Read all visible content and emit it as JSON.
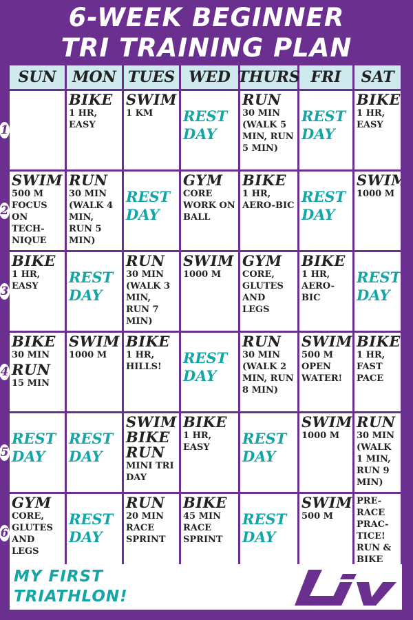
{
  "title": {
    "line1": "6-WEEK BEGINNER",
    "line2": "TRI TRAINING PLAN"
  },
  "days": [
    "SUN",
    "MON",
    "TUES",
    "WED",
    "THURS",
    "FRI",
    "SAT"
  ],
  "weeks": [
    {
      "label": "1",
      "cells": [
        {
          "lines": []
        },
        {
          "lines": [
            {
              "k": "act",
              "t": "BIKE"
            },
            {
              "k": "det",
              "t": "1 HR, EASY"
            }
          ]
        },
        {
          "lines": [
            {
              "k": "act",
              "t": "SWIM"
            },
            {
              "k": "det",
              "t": "1 KM"
            }
          ]
        },
        {
          "lines": [
            {
              "k": "rest",
              "t": "REST DAY"
            }
          ]
        },
        {
          "lines": [
            {
              "k": "act",
              "t": "RUN"
            },
            {
              "k": "det",
              "t": "30 MIN (WALK 5 MIN, RUN 5 MIN)"
            }
          ]
        },
        {
          "lines": [
            {
              "k": "rest",
              "t": "REST DAY"
            }
          ]
        },
        {
          "lines": [
            {
              "k": "act",
              "t": "BIKE"
            },
            {
              "k": "det",
              "t": "1 HR, EASY"
            }
          ]
        }
      ]
    },
    {
      "label": "2",
      "cells": [
        {
          "lines": [
            {
              "k": "act",
              "t": "SWIM"
            },
            {
              "k": "det",
              "t": "500 M FOCUS ON TECH-NIQUE"
            }
          ]
        },
        {
          "lines": [
            {
              "k": "act",
              "t": "RUN"
            },
            {
              "k": "det",
              "t": "30 MIN (WALK 4 MIN, RUN 5 MIN)"
            }
          ]
        },
        {
          "lines": [
            {
              "k": "rest",
              "t": "REST DAY"
            }
          ]
        },
        {
          "lines": [
            {
              "k": "act",
              "t": "GYM"
            },
            {
              "k": "det",
              "t": "CORE WORK ON BALL"
            }
          ]
        },
        {
          "lines": [
            {
              "k": "act",
              "t": "BIKE"
            },
            {
              "k": "det",
              "t": "1 HR, AERO-BIC"
            }
          ]
        },
        {
          "lines": [
            {
              "k": "rest",
              "t": "REST DAY"
            }
          ]
        },
        {
          "lines": [
            {
              "k": "act",
              "t": "SWIM"
            },
            {
              "k": "det",
              "t": "1000 M"
            }
          ]
        }
      ]
    },
    {
      "label": "3",
      "cells": [
        {
          "lines": [
            {
              "k": "act",
              "t": "BIKE"
            },
            {
              "k": "det",
              "t": "1 HR, EASY"
            }
          ]
        },
        {
          "lines": [
            {
              "k": "rest",
              "t": "REST DAY"
            }
          ]
        },
        {
          "lines": [
            {
              "k": "act",
              "t": "RUN"
            },
            {
              "k": "det",
              "t": "30 MIN (WALK 3 MIN, RUN 7 MIN)"
            }
          ]
        },
        {
          "lines": [
            {
              "k": "act",
              "t": "SWIM"
            },
            {
              "k": "det",
              "t": "1000 M"
            }
          ]
        },
        {
          "lines": [
            {
              "k": "act",
              "t": "GYM"
            },
            {
              "k": "det",
              "t": "CORE, GLUTES AND LEGS"
            }
          ]
        },
        {
          "lines": [
            {
              "k": "act",
              "t": "BIKE"
            },
            {
              "k": "det",
              "t": "1 HR, AERO-BIC"
            }
          ]
        },
        {
          "lines": [
            {
              "k": "rest",
              "t": "REST DAY"
            }
          ]
        }
      ]
    },
    {
      "label": "4",
      "cells": [
        {
          "lines": [
            {
              "k": "act",
              "t": "BIKE"
            },
            {
              "k": "det",
              "t": "30 MIN"
            },
            {
              "k": "act",
              "t": "RUN"
            },
            {
              "k": "det",
              "t": "15 MIN"
            }
          ]
        },
        {
          "lines": [
            {
              "k": "act",
              "t": "SWIM"
            },
            {
              "k": "det",
              "t": "1000 M"
            }
          ]
        },
        {
          "lines": [
            {
              "k": "act",
              "t": "BIKE"
            },
            {
              "k": "det",
              "t": "1 HR, HILLS!"
            }
          ]
        },
        {
          "lines": [
            {
              "k": "rest",
              "t": "REST DAY"
            }
          ]
        },
        {
          "lines": [
            {
              "k": "act",
              "t": "RUN"
            },
            {
              "k": "det",
              "t": "30 MIN (WALK 2 MIN, RUN 8 MIN)"
            }
          ]
        },
        {
          "lines": [
            {
              "k": "act",
              "t": "SWIM"
            },
            {
              "k": "det",
              "t": "500 M OPEN WATER!"
            }
          ]
        },
        {
          "lines": [
            {
              "k": "act",
              "t": "BIKE"
            },
            {
              "k": "det",
              "t": "1 HR, FAST PACE"
            }
          ]
        }
      ]
    },
    {
      "label": "5",
      "cells": [
        {
          "lines": [
            {
              "k": "rest",
              "t": "REST DAY"
            }
          ]
        },
        {
          "lines": [
            {
              "k": "rest",
              "t": "REST DAY"
            }
          ]
        },
        {
          "lines": [
            {
              "k": "act",
              "t": "SWIM"
            },
            {
              "k": "act",
              "t": "BIKE"
            },
            {
              "k": "act",
              "t": "RUN"
            },
            {
              "k": "det",
              "t": "MINI TRI DAY"
            }
          ]
        },
        {
          "lines": [
            {
              "k": "act",
              "t": "BIKE"
            },
            {
              "k": "det",
              "t": "1 HR, EASY"
            }
          ]
        },
        {
          "lines": [
            {
              "k": "rest",
              "t": "REST DAY"
            }
          ]
        },
        {
          "lines": [
            {
              "k": "act",
              "t": "SWIM"
            },
            {
              "k": "det",
              "t": "1000 M"
            }
          ]
        },
        {
          "lines": [
            {
              "k": "act",
              "t": "RUN"
            },
            {
              "k": "det",
              "t": "30 MIN (WALK 1 MIN, RUN 9 MIN)"
            }
          ]
        }
      ]
    },
    {
      "label": "6",
      "cells": [
        {
          "lines": [
            {
              "k": "act",
              "t": "GYM"
            },
            {
              "k": "det",
              "t": "CORE, GLUTES AND LEGS"
            }
          ]
        },
        {
          "lines": [
            {
              "k": "rest",
              "t": "REST DAY"
            }
          ]
        },
        {
          "lines": [
            {
              "k": "act",
              "t": "RUN"
            },
            {
              "k": "det",
              "t": "20 MIN RACE SPRINT"
            }
          ]
        },
        {
          "lines": [
            {
              "k": "act",
              "t": "BIKE"
            },
            {
              "k": "det",
              "t": "45 MIN RACE SPRINT"
            }
          ]
        },
        {
          "lines": [
            {
              "k": "rest",
              "t": "REST DAY"
            }
          ]
        },
        {
          "lines": [
            {
              "k": "act",
              "t": "SWIM"
            },
            {
              "k": "det",
              "t": "500 M"
            }
          ]
        },
        {
          "lines": [
            {
              "k": "det",
              "t": "PRE-RACE PRAC-TICE! RUN & BIKE"
            }
          ]
        }
      ]
    }
  ],
  "footer": {
    "line1": "MY FIRST",
    "line2": "TRIATHLON!",
    "logo_text": "Liv"
  },
  "colors": {
    "background": "#6a2f8f",
    "header": "#cfeaee",
    "rest": "#14a6a6",
    "logo": "#6a2f8f"
  }
}
